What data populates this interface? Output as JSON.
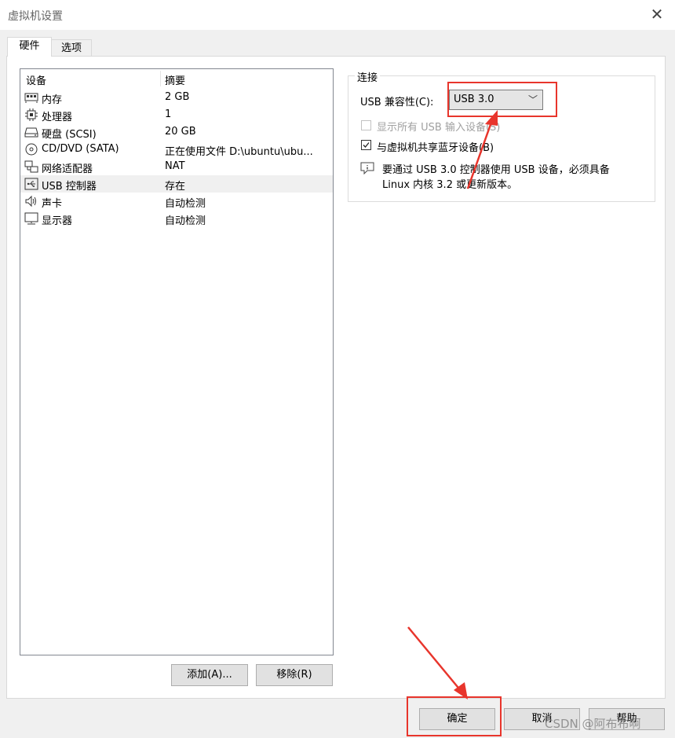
{
  "window": {
    "title": "虚拟机设置",
    "close_glyph": "✕"
  },
  "tabs": [
    {
      "label": "硬件",
      "active": true
    },
    {
      "label": "选项",
      "active": false
    }
  ],
  "device_list": {
    "columns": [
      "设备",
      "摘要"
    ],
    "rows": [
      {
        "icon": "memory-icon",
        "name": "内存",
        "summary": "2 GB",
        "selected": false
      },
      {
        "icon": "processor-icon",
        "name": "处理器",
        "summary": "1",
        "selected": false
      },
      {
        "icon": "hard-disk-icon",
        "name": "硬盘 (SCSI)",
        "summary": "20 GB",
        "selected": false
      },
      {
        "icon": "cd-dvd-icon",
        "name": "CD/DVD (SATA)",
        "summary": "正在使用文件 D:\\ubuntu\\ubu...",
        "selected": false
      },
      {
        "icon": "network-adapter-icon",
        "name": "网络适配器",
        "summary": "NAT",
        "selected": false
      },
      {
        "icon": "usb-icon",
        "name": "USB 控制器",
        "summary": "存在",
        "selected": true
      },
      {
        "icon": "sound-card-icon",
        "name": "声卡",
        "summary": "自动检测",
        "selected": false
      },
      {
        "icon": "display-icon",
        "name": "显示器",
        "summary": "自动检测",
        "selected": false
      }
    ]
  },
  "list_buttons": {
    "add": "添加(A)...",
    "remove": "移除(R)"
  },
  "connection": {
    "legend": "连接",
    "usb_compat_label": "USB 兼容性(C):",
    "usb_compat_value": "USB 3.0",
    "show_all_usb_label": "显示所有 USB 输入设备(S)",
    "show_all_usb_checked": false,
    "show_all_usb_enabled": false,
    "share_bluetooth_label": "与虚拟机共享蓝牙设备(B)",
    "share_bluetooth_checked": true,
    "info_line1": "要通过 USB 3.0 控制器使用 USB 设备，必须具备",
    "info_line2": "Linux 内核 3.2 或更新版本。"
  },
  "footer": {
    "ok": "确定",
    "cancel": "取消",
    "help": "帮助"
  },
  "watermark": "CSDN @阿布布啊",
  "colors": {
    "annotation_red": "#e8352c",
    "selection_bg": "#f0f0f0",
    "button_bg": "#e1e1e1"
  }
}
